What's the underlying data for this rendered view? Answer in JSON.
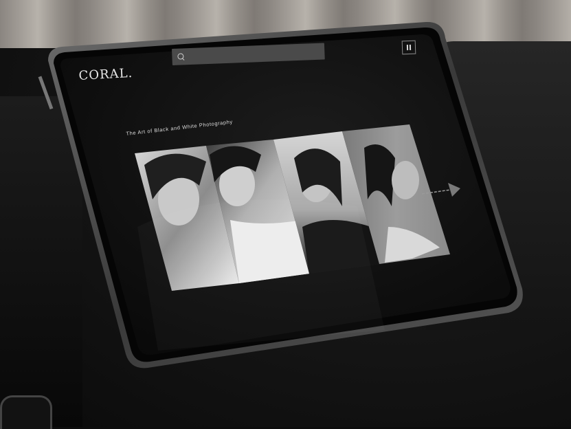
{
  "app": {
    "logo_text": "CORAL."
  },
  "header": {
    "search": {
      "placeholder": "",
      "value": ""
    },
    "menu_icon": "pause-icon"
  },
  "main": {
    "heading": "The Art of Black and White Photography",
    "gallery": [
      {
        "subject": "portrait-1",
        "tone": "light"
      },
      {
        "subject": "portrait-2",
        "tone": "mid"
      },
      {
        "subject": "portrait-3",
        "tone": "light"
      },
      {
        "subject": "portrait-4",
        "tone": "grey"
      }
    ],
    "next_icon": "arrow-right-icon"
  },
  "colors": {
    "screen_bg": "#0e0e0e",
    "search_bg": "#4a4a4a",
    "text": "#e8e8e8"
  }
}
